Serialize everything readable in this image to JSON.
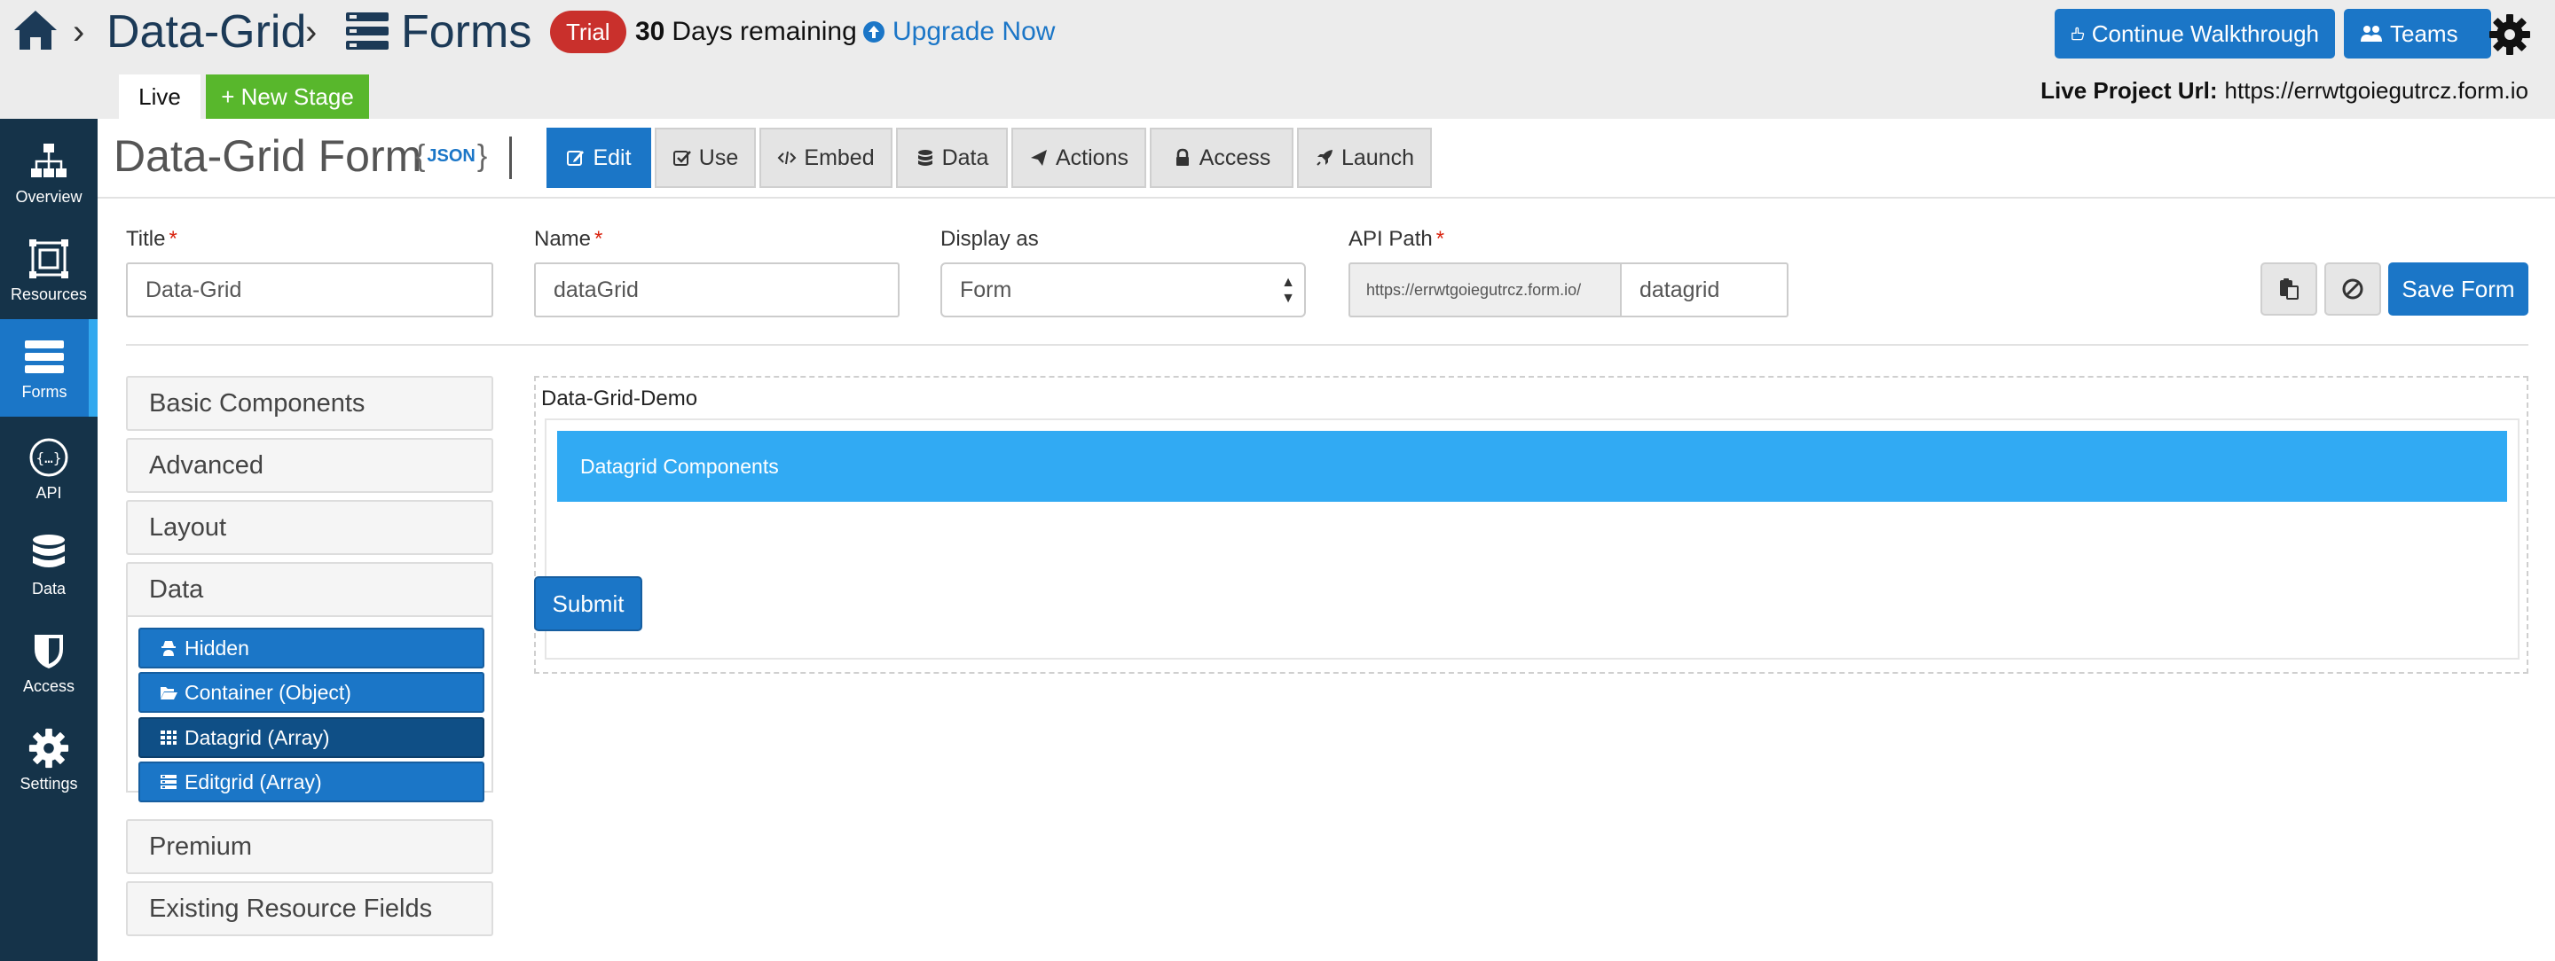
{
  "header": {
    "project_name": "Data-Grid",
    "forms_label": "Forms",
    "breadcrumb_sep": "›",
    "trial_badge": "Trial",
    "days_count": "30",
    "days_text": "Days remaining",
    "upgrade_label": "Upgrade Now",
    "continue_walkthrough_label": "Continue Walkthrough",
    "teams_label": "Teams",
    "live_tab_label": "Live",
    "new_stage_label": "+ New Stage",
    "live_url_label": "Live Project Url:",
    "live_url_value": "https://errwtgoiegutrcz.form.io"
  },
  "sidebar": {
    "items": [
      {
        "label": "Overview",
        "icon": "sitemap-icon"
      },
      {
        "label": "Resources",
        "icon": "resources-icon"
      },
      {
        "label": "Forms",
        "icon": "forms-icon",
        "active": true
      },
      {
        "label": "API",
        "icon": "api-icon"
      },
      {
        "label": "Data",
        "icon": "database-icon"
      },
      {
        "label": "Access",
        "icon": "shield-icon"
      },
      {
        "label": "Settings",
        "icon": "gear-icon"
      }
    ]
  },
  "form_header": {
    "title": "Data-Grid Form",
    "json_label": "JSON",
    "json_open": "{",
    "json_close": "}",
    "tabs": [
      {
        "label": "Edit",
        "active": true
      },
      {
        "label": "Use"
      },
      {
        "label": "Embed"
      },
      {
        "label": "Data"
      },
      {
        "label": "Actions"
      },
      {
        "label": "Access"
      },
      {
        "label": "Launch"
      }
    ]
  },
  "fields": {
    "title_label": "Title",
    "title_value": "Data-Grid",
    "name_label": "Name",
    "name_value": "dataGrid",
    "display_label": "Display as",
    "display_value": "Form",
    "api_label": "API Path",
    "api_prefix": "https://errwtgoiegutrcz.form.io/",
    "api_value": "datagrid",
    "required_mark": "*",
    "save_label": "Save Form"
  },
  "builder": {
    "groups": [
      "Basic Components",
      "Advanced",
      "Layout",
      "Data",
      "Premium",
      "Existing Resource Fields"
    ],
    "data_components": [
      "Hidden",
      "Container (Object)",
      "Datagrid (Array)",
      "Editgrid (Array)"
    ]
  },
  "canvas": {
    "datagrid_label": "Data-Grid-Demo",
    "datagrid_header": "Datagrid Components",
    "submit_label": "Submit"
  },
  "colors": {
    "primary": "#1b76c7",
    "sidebar": "#153349",
    "trial": "#c9302c",
    "new_stage": "#58b72c",
    "datagrid_header": "#31aaf3"
  }
}
